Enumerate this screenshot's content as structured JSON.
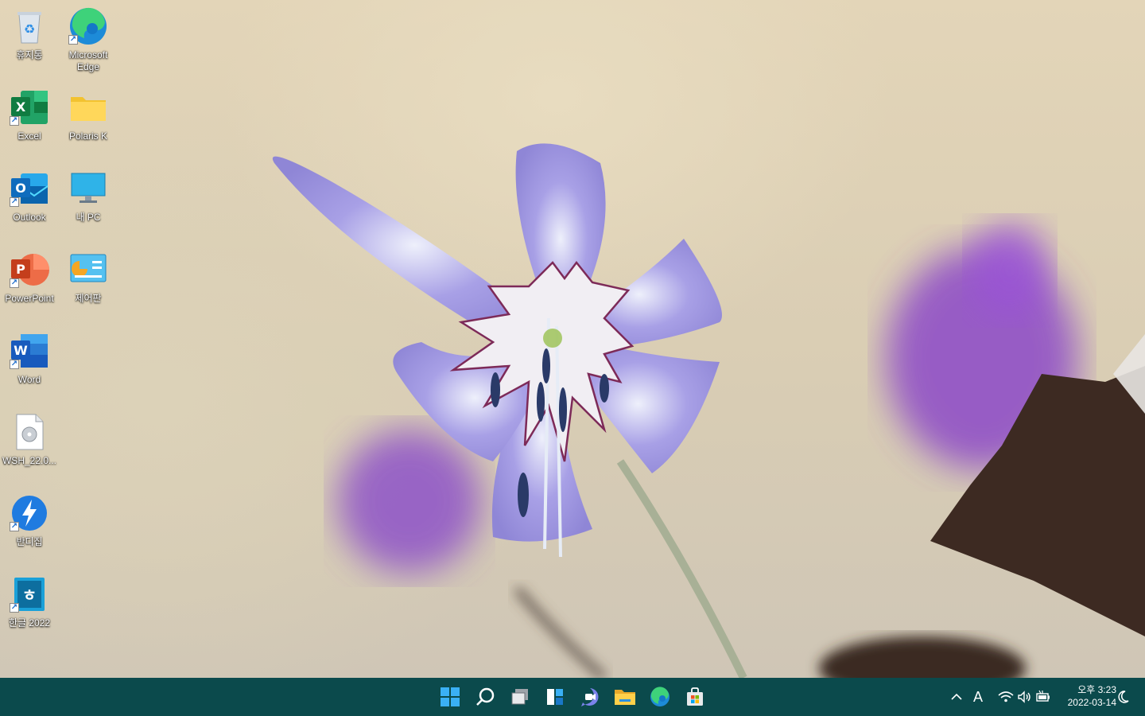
{
  "desktop": {
    "icons": [
      {
        "id": "recycle",
        "label": "휴지통"
      },
      {
        "id": "edge",
        "label": "Microsoft Edge"
      },
      {
        "id": "excel",
        "label": "Excel"
      },
      {
        "id": "polaris",
        "label": "Polaris K"
      },
      {
        "id": "outlook",
        "label": "Outlook"
      },
      {
        "id": "mypc",
        "label": "내 PC"
      },
      {
        "id": "powerpoint",
        "label": "PowerPoint"
      },
      {
        "id": "control",
        "label": "제어판"
      },
      {
        "id": "word",
        "label": "Word"
      },
      {
        "id": "wsh",
        "label": "WSH_22.0..."
      },
      {
        "id": "bandizip",
        "label": "반디집"
      },
      {
        "id": "hwp",
        "label": "한글 2022"
      }
    ]
  },
  "taskbar": {
    "apps": [
      "start-icon",
      "search-icon",
      "task-view-icon",
      "widgets-icon",
      "chat-icon",
      "file-explorer-icon",
      "edge-icon",
      "store-icon"
    ],
    "tray": {
      "ime": "A",
      "time": "오후 3:23",
      "date": "2022-03-14"
    }
  },
  "colors": {
    "taskbar": "#0b4a4c",
    "petal": "#9d94e0"
  }
}
